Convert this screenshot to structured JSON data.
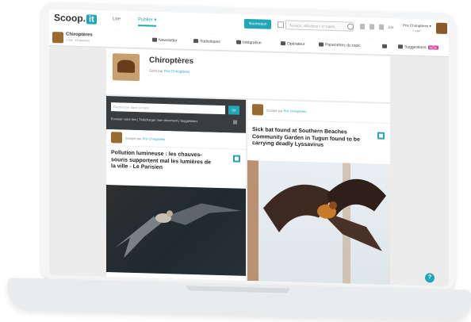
{
  "topbar": {
    "logo_text": "Scoop.",
    "logo_badge": "it",
    "nav_read": "Lire",
    "nav_publish": "Publier ▾",
    "create_button": "Nouveaux",
    "search_placeholder": "Scoops, utilisateurs et sujets",
    "lang": "EN",
    "user_name": "Prix Chiroptères ▾",
    "user_sub": "1 sujet"
  },
  "subbar": {
    "topic_title": "Chiroptères",
    "topic_meta": "1 vue · 16 abonnés",
    "items": [
      {
        "label": "Newsletter"
      },
      {
        "label": "Statistiques"
      },
      {
        "label": "Intégration"
      },
      {
        "label": "Opérateur"
      },
      {
        "label": "Paramètres du topic"
      },
      {
        "label": "Suggestions"
      }
    ],
    "suggestions_badge": "NEW"
  },
  "topic": {
    "title": "Chiroptères",
    "curated_by_prefix": "Géré par ",
    "curated_by_name": "Prix Chiroptères"
  },
  "search_panel": {
    "placeholder": "Rechercher dans ce topic",
    "button": "OK",
    "links": "Envoyer votre lien   |   Télécharger mon document   |   Suggestions"
  },
  "posts": [
    {
      "curator_prefix": "Scoopé par ",
      "curator_name": "Prix Chiroptères",
      "title": "Pollution lumineuse : les chauves-souris supportent mal les lumières de la ville - Le Parisien",
      "link_icon": "external-link-icon"
    },
    {
      "curator_prefix": "Scoopé par ",
      "curator_name": "Prix Chiroptères",
      "title": "Sick bat found at Southern Beaches Community Garden in Tugun found to be carrying deadly Lyssavirus",
      "link_icon": "external-link-icon"
    }
  ],
  "help_label": "?",
  "colors": {
    "accent": "#21a6b7",
    "badge": "#d040a0",
    "dark_panel": "#3a3d40"
  }
}
